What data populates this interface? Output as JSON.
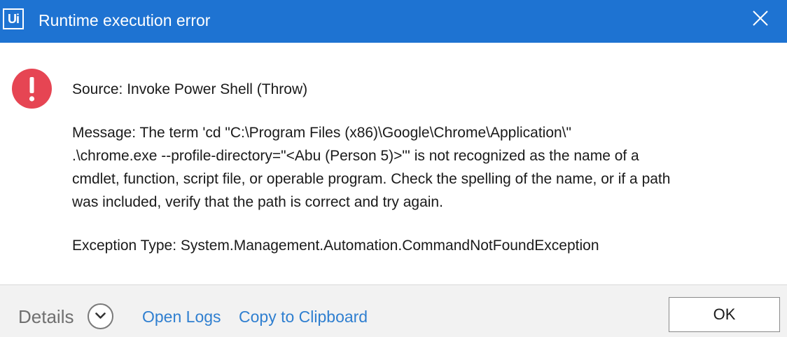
{
  "window": {
    "app_logo_text": "Ui",
    "title": "Runtime execution error",
    "close_icon": "close-icon",
    "title_bar_color": "#1e73d2"
  },
  "error": {
    "icon": "error-exclamation-icon",
    "icon_color": "#e64553",
    "source": "Source: Invoke Power Shell (Throw)",
    "message_lines": [
      "Message: The term 'cd \"C:\\Program Files (x86)\\Google\\Chrome\\Application\\\"",
      ".\\chrome.exe --profile-directory=\"<Abu (Person 5)>\"' is not recognized as the name of a",
      "cmdlet, function, script file, or operable program. Check the spelling of the name, or if a path",
      "was included, verify that the path is correct and try again."
    ],
    "exception_type": "Exception Type: System.Management.Automation.CommandNotFoundException"
  },
  "footer": {
    "details_label": "Details",
    "details_icon": "chevron-down-icon",
    "open_logs_label": "Open Logs",
    "copy_label": "Copy to Clipboard",
    "ok_label": "OK",
    "link_color": "#2f7fd0"
  }
}
